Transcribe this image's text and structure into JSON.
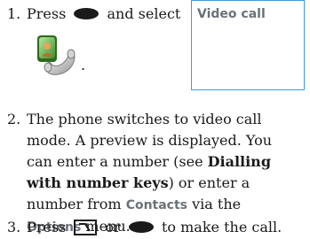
{
  "step1": {
    "number": "1.",
    "text_press": "Press",
    "text_and_select": "and select",
    "ui_label": "Video call",
    "period": "."
  },
  "step2": {
    "number": "2.",
    "line1": "The phone switches to video call",
    "line2": "mode. A preview is displayed. You",
    "line3_pre": "can enter a number (see ",
    "xref_part1": "Dialling",
    "xref_part2": "with number keys",
    "line4_post": ") or enter a",
    "line5_pre": "number from ",
    "contacts_label": "Contacts",
    "line5_post": " via the",
    "options_label": "Options",
    "line6_post": " menu."
  },
  "step3": {
    "number": "3.",
    "text_press": "Press",
    "text_or": "or",
    "text_end": "to make the call."
  },
  "icons": {
    "center_key": "oval-key-icon",
    "video_call": "video-call-phone-icon",
    "call_key": "call-key-icon"
  },
  "colors": {
    "ui_text": "#6a7278",
    "callout_border": "#3c9ddd",
    "body_text": "#1a1a1a"
  }
}
